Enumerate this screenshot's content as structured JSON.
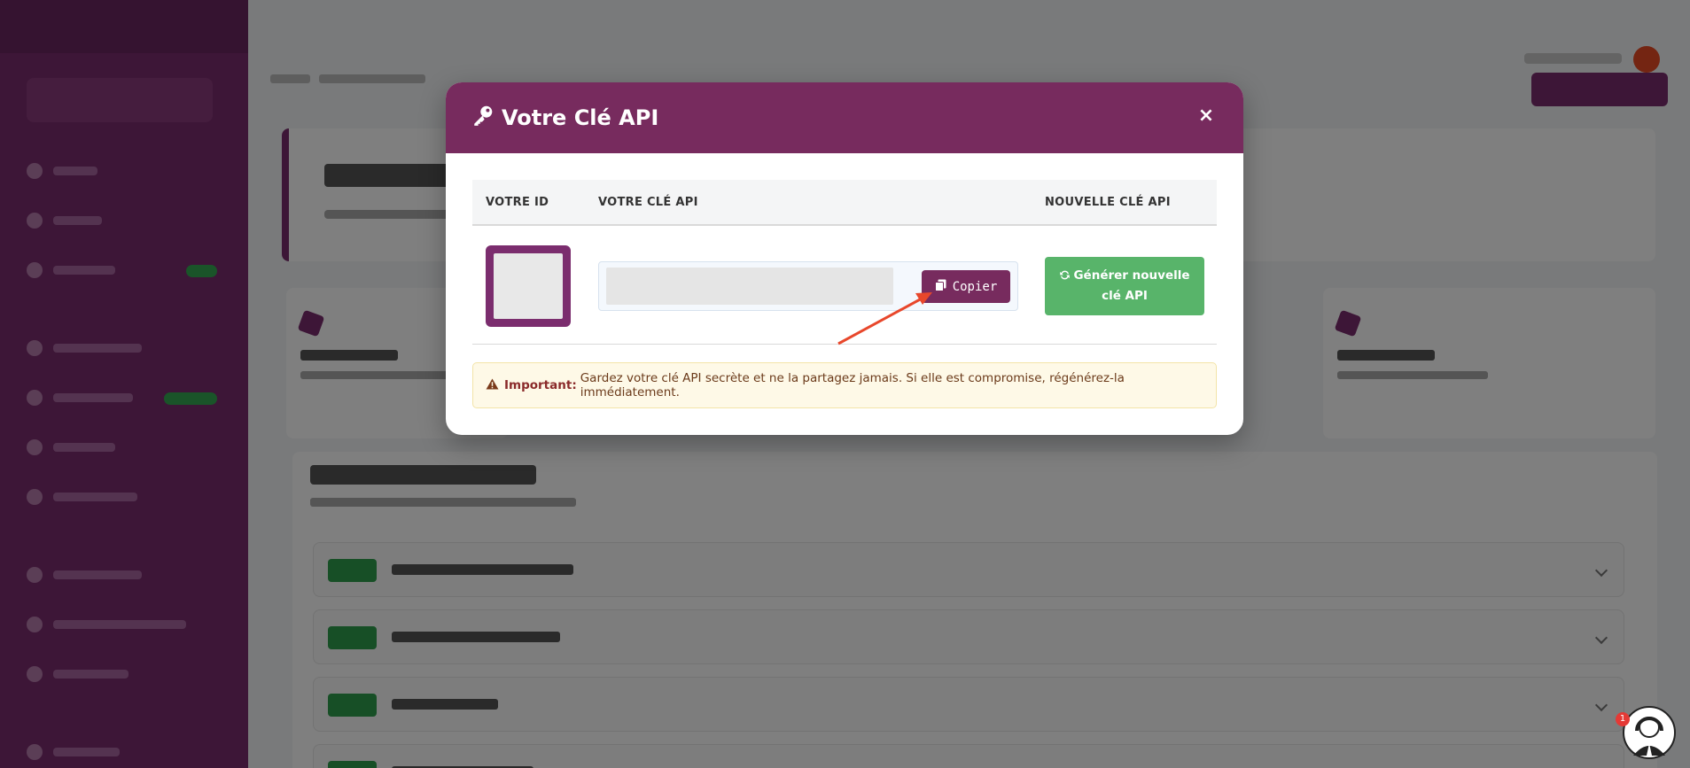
{
  "modal": {
    "title": "Votre Clé API",
    "close_label": "×",
    "columns": {
      "id": "VOTRE ID",
      "key": "VOTRE CLÉ API",
      "new_key": "NOUVELLE CLÉ API"
    },
    "copy_label": "Copier",
    "generate_label": "Générer nouvelle clé API",
    "alert_strong": "Important:",
    "alert_text": "Gardez votre clé API secrète et ne la partagez jamais. Si elle est compromise, régénérez-la immédiatement."
  },
  "support": {
    "notification_count": "1"
  },
  "colors": {
    "brand": "#772b5e",
    "success": "#58b46a",
    "annotation_arrow": "#e8472b"
  }
}
